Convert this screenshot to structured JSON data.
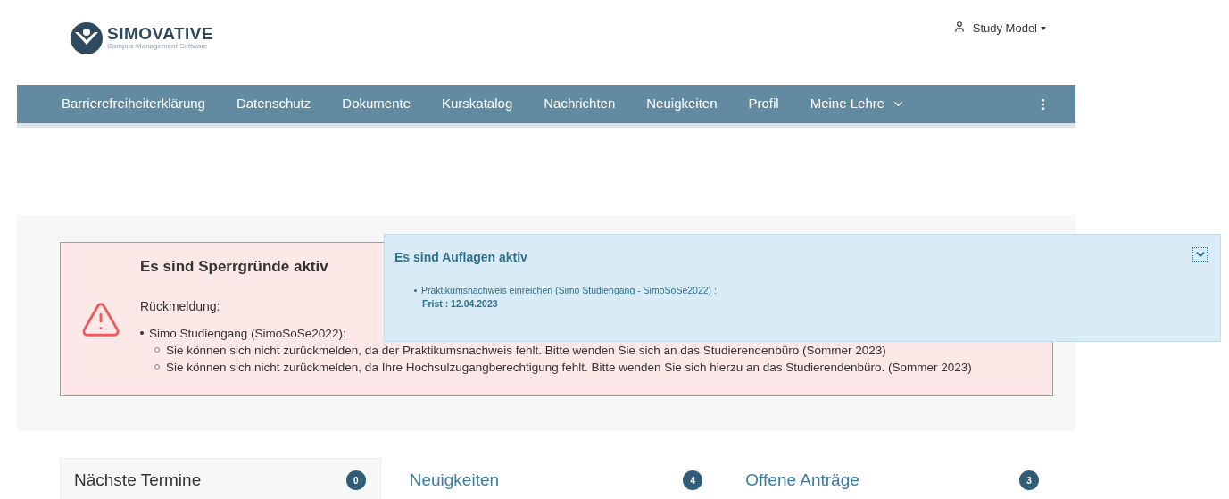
{
  "header": {
    "logo_name": "SIMOVATIVE",
    "logo_tagline": "Campus Management Software",
    "user_menu": "Study Model"
  },
  "nav": {
    "items": [
      "Barrierefreiheiterklärung",
      "Datenschutz",
      "Dokumente",
      "Kurskatalog",
      "Nachrichten",
      "Neuigkeiten",
      "Profil"
    ],
    "dropdown": "Meine Lehre"
  },
  "blocking_alert": {
    "title": "Es sind Sperrgründe aktiv",
    "subtitle": "Rückmeldung:",
    "items": [
      {
        "text": "Simo Studiengang (SimoSoSe2022):",
        "children": [
          {
            "text": "Sie können sich nicht zurückmelden, da der Praktikumsnachweis fehlt. Bitte wenden Sie sich an das Studierendenbüro (Sommer 2023)"
          },
          {
            "text": "Sie können sich nicht zurückmelden, da Ihre Hochsulzugangberechtigung fehlt. Bitte wenden Sie sich hierzu an das Studierendenbüro. (Sommer 2023)"
          }
        ]
      }
    ]
  },
  "requirements_panel": {
    "title": "Es sind Auflagen aktiv",
    "expanded": true,
    "items": [
      {
        "text": "Praktikumsnachweis einreichen (Simo Studiengang - SimoSoSe2022) :",
        "deadline": "Frist : 12.04.2023"
      }
    ]
  },
  "tabs": [
    {
      "label": "Nächste Termine",
      "count": "0",
      "selected": true
    },
    {
      "label": "Neuigkeiten",
      "count": "4",
      "selected": false
    },
    {
      "label": "Offene Anträge",
      "count": "3",
      "selected": false
    }
  ]
}
